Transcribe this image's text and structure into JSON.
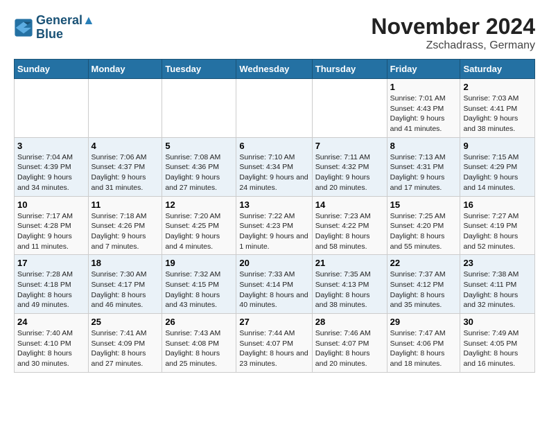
{
  "logo": {
    "line1": "General",
    "line2": "Blue"
  },
  "title": "November 2024",
  "subtitle": "Zschadrass, Germany",
  "headers": [
    "Sunday",
    "Monday",
    "Tuesday",
    "Wednesday",
    "Thursday",
    "Friday",
    "Saturday"
  ],
  "weeks": [
    [
      {
        "day": "",
        "info": ""
      },
      {
        "day": "",
        "info": ""
      },
      {
        "day": "",
        "info": ""
      },
      {
        "day": "",
        "info": ""
      },
      {
        "day": "",
        "info": ""
      },
      {
        "day": "1",
        "info": "Sunrise: 7:01 AM\nSunset: 4:43 PM\nDaylight: 9 hours and 41 minutes."
      },
      {
        "day": "2",
        "info": "Sunrise: 7:03 AM\nSunset: 4:41 PM\nDaylight: 9 hours and 38 minutes."
      }
    ],
    [
      {
        "day": "3",
        "info": "Sunrise: 7:04 AM\nSunset: 4:39 PM\nDaylight: 9 hours and 34 minutes."
      },
      {
        "day": "4",
        "info": "Sunrise: 7:06 AM\nSunset: 4:37 PM\nDaylight: 9 hours and 31 minutes."
      },
      {
        "day": "5",
        "info": "Sunrise: 7:08 AM\nSunset: 4:36 PM\nDaylight: 9 hours and 27 minutes."
      },
      {
        "day": "6",
        "info": "Sunrise: 7:10 AM\nSunset: 4:34 PM\nDaylight: 9 hours and 24 minutes."
      },
      {
        "day": "7",
        "info": "Sunrise: 7:11 AM\nSunset: 4:32 PM\nDaylight: 9 hours and 20 minutes."
      },
      {
        "day": "8",
        "info": "Sunrise: 7:13 AM\nSunset: 4:31 PM\nDaylight: 9 hours and 17 minutes."
      },
      {
        "day": "9",
        "info": "Sunrise: 7:15 AM\nSunset: 4:29 PM\nDaylight: 9 hours and 14 minutes."
      }
    ],
    [
      {
        "day": "10",
        "info": "Sunrise: 7:17 AM\nSunset: 4:28 PM\nDaylight: 9 hours and 11 minutes."
      },
      {
        "day": "11",
        "info": "Sunrise: 7:18 AM\nSunset: 4:26 PM\nDaylight: 9 hours and 7 minutes."
      },
      {
        "day": "12",
        "info": "Sunrise: 7:20 AM\nSunset: 4:25 PM\nDaylight: 9 hours and 4 minutes."
      },
      {
        "day": "13",
        "info": "Sunrise: 7:22 AM\nSunset: 4:23 PM\nDaylight: 9 hours and 1 minute."
      },
      {
        "day": "14",
        "info": "Sunrise: 7:23 AM\nSunset: 4:22 PM\nDaylight: 8 hours and 58 minutes."
      },
      {
        "day": "15",
        "info": "Sunrise: 7:25 AM\nSunset: 4:20 PM\nDaylight: 8 hours and 55 minutes."
      },
      {
        "day": "16",
        "info": "Sunrise: 7:27 AM\nSunset: 4:19 PM\nDaylight: 8 hours and 52 minutes."
      }
    ],
    [
      {
        "day": "17",
        "info": "Sunrise: 7:28 AM\nSunset: 4:18 PM\nDaylight: 8 hours and 49 minutes."
      },
      {
        "day": "18",
        "info": "Sunrise: 7:30 AM\nSunset: 4:17 PM\nDaylight: 8 hours and 46 minutes."
      },
      {
        "day": "19",
        "info": "Sunrise: 7:32 AM\nSunset: 4:15 PM\nDaylight: 8 hours and 43 minutes."
      },
      {
        "day": "20",
        "info": "Sunrise: 7:33 AM\nSunset: 4:14 PM\nDaylight: 8 hours and 40 minutes."
      },
      {
        "day": "21",
        "info": "Sunrise: 7:35 AM\nSunset: 4:13 PM\nDaylight: 8 hours and 38 minutes."
      },
      {
        "day": "22",
        "info": "Sunrise: 7:37 AM\nSunset: 4:12 PM\nDaylight: 8 hours and 35 minutes."
      },
      {
        "day": "23",
        "info": "Sunrise: 7:38 AM\nSunset: 4:11 PM\nDaylight: 8 hours and 32 minutes."
      }
    ],
    [
      {
        "day": "24",
        "info": "Sunrise: 7:40 AM\nSunset: 4:10 PM\nDaylight: 8 hours and 30 minutes."
      },
      {
        "day": "25",
        "info": "Sunrise: 7:41 AM\nSunset: 4:09 PM\nDaylight: 8 hours and 27 minutes."
      },
      {
        "day": "26",
        "info": "Sunrise: 7:43 AM\nSunset: 4:08 PM\nDaylight: 8 hours and 25 minutes."
      },
      {
        "day": "27",
        "info": "Sunrise: 7:44 AM\nSunset: 4:07 PM\nDaylight: 8 hours and 23 minutes."
      },
      {
        "day": "28",
        "info": "Sunrise: 7:46 AM\nSunset: 4:07 PM\nDaylight: 8 hours and 20 minutes."
      },
      {
        "day": "29",
        "info": "Sunrise: 7:47 AM\nSunset: 4:06 PM\nDaylight: 8 hours and 18 minutes."
      },
      {
        "day": "30",
        "info": "Sunrise: 7:49 AM\nSunset: 4:05 PM\nDaylight: 8 hours and 16 minutes."
      }
    ]
  ]
}
